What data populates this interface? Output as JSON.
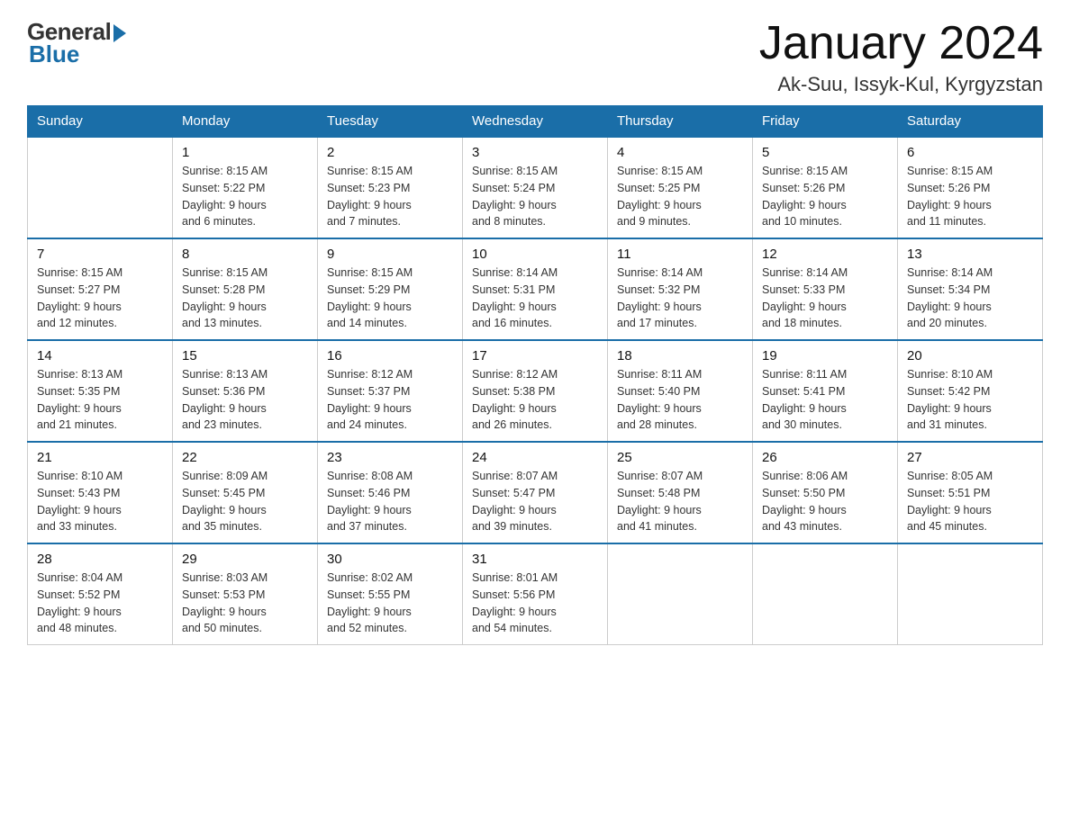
{
  "header": {
    "logo": {
      "general": "General",
      "blue": "Blue"
    },
    "month": "January 2024",
    "location": "Ak-Suu, Issyk-Kul, Kyrgyzstan"
  },
  "weekdays": [
    "Sunday",
    "Monday",
    "Tuesday",
    "Wednesday",
    "Thursday",
    "Friday",
    "Saturday"
  ],
  "weeks": [
    [
      {
        "day": "",
        "info": ""
      },
      {
        "day": "1",
        "info": "Sunrise: 8:15 AM\nSunset: 5:22 PM\nDaylight: 9 hours\nand 6 minutes."
      },
      {
        "day": "2",
        "info": "Sunrise: 8:15 AM\nSunset: 5:23 PM\nDaylight: 9 hours\nand 7 minutes."
      },
      {
        "day": "3",
        "info": "Sunrise: 8:15 AM\nSunset: 5:24 PM\nDaylight: 9 hours\nand 8 minutes."
      },
      {
        "day": "4",
        "info": "Sunrise: 8:15 AM\nSunset: 5:25 PM\nDaylight: 9 hours\nand 9 minutes."
      },
      {
        "day": "5",
        "info": "Sunrise: 8:15 AM\nSunset: 5:26 PM\nDaylight: 9 hours\nand 10 minutes."
      },
      {
        "day": "6",
        "info": "Sunrise: 8:15 AM\nSunset: 5:26 PM\nDaylight: 9 hours\nand 11 minutes."
      }
    ],
    [
      {
        "day": "7",
        "info": "Sunrise: 8:15 AM\nSunset: 5:27 PM\nDaylight: 9 hours\nand 12 minutes."
      },
      {
        "day": "8",
        "info": "Sunrise: 8:15 AM\nSunset: 5:28 PM\nDaylight: 9 hours\nand 13 minutes."
      },
      {
        "day": "9",
        "info": "Sunrise: 8:15 AM\nSunset: 5:29 PM\nDaylight: 9 hours\nand 14 minutes."
      },
      {
        "day": "10",
        "info": "Sunrise: 8:14 AM\nSunset: 5:31 PM\nDaylight: 9 hours\nand 16 minutes."
      },
      {
        "day": "11",
        "info": "Sunrise: 8:14 AM\nSunset: 5:32 PM\nDaylight: 9 hours\nand 17 minutes."
      },
      {
        "day": "12",
        "info": "Sunrise: 8:14 AM\nSunset: 5:33 PM\nDaylight: 9 hours\nand 18 minutes."
      },
      {
        "day": "13",
        "info": "Sunrise: 8:14 AM\nSunset: 5:34 PM\nDaylight: 9 hours\nand 20 minutes."
      }
    ],
    [
      {
        "day": "14",
        "info": "Sunrise: 8:13 AM\nSunset: 5:35 PM\nDaylight: 9 hours\nand 21 minutes."
      },
      {
        "day": "15",
        "info": "Sunrise: 8:13 AM\nSunset: 5:36 PM\nDaylight: 9 hours\nand 23 minutes."
      },
      {
        "day": "16",
        "info": "Sunrise: 8:12 AM\nSunset: 5:37 PM\nDaylight: 9 hours\nand 24 minutes."
      },
      {
        "day": "17",
        "info": "Sunrise: 8:12 AM\nSunset: 5:38 PM\nDaylight: 9 hours\nand 26 minutes."
      },
      {
        "day": "18",
        "info": "Sunrise: 8:11 AM\nSunset: 5:40 PM\nDaylight: 9 hours\nand 28 minutes."
      },
      {
        "day": "19",
        "info": "Sunrise: 8:11 AM\nSunset: 5:41 PM\nDaylight: 9 hours\nand 30 minutes."
      },
      {
        "day": "20",
        "info": "Sunrise: 8:10 AM\nSunset: 5:42 PM\nDaylight: 9 hours\nand 31 minutes."
      }
    ],
    [
      {
        "day": "21",
        "info": "Sunrise: 8:10 AM\nSunset: 5:43 PM\nDaylight: 9 hours\nand 33 minutes."
      },
      {
        "day": "22",
        "info": "Sunrise: 8:09 AM\nSunset: 5:45 PM\nDaylight: 9 hours\nand 35 minutes."
      },
      {
        "day": "23",
        "info": "Sunrise: 8:08 AM\nSunset: 5:46 PM\nDaylight: 9 hours\nand 37 minutes."
      },
      {
        "day": "24",
        "info": "Sunrise: 8:07 AM\nSunset: 5:47 PM\nDaylight: 9 hours\nand 39 minutes."
      },
      {
        "day": "25",
        "info": "Sunrise: 8:07 AM\nSunset: 5:48 PM\nDaylight: 9 hours\nand 41 minutes."
      },
      {
        "day": "26",
        "info": "Sunrise: 8:06 AM\nSunset: 5:50 PM\nDaylight: 9 hours\nand 43 minutes."
      },
      {
        "day": "27",
        "info": "Sunrise: 8:05 AM\nSunset: 5:51 PM\nDaylight: 9 hours\nand 45 minutes."
      }
    ],
    [
      {
        "day": "28",
        "info": "Sunrise: 8:04 AM\nSunset: 5:52 PM\nDaylight: 9 hours\nand 48 minutes."
      },
      {
        "day": "29",
        "info": "Sunrise: 8:03 AM\nSunset: 5:53 PM\nDaylight: 9 hours\nand 50 minutes."
      },
      {
        "day": "30",
        "info": "Sunrise: 8:02 AM\nSunset: 5:55 PM\nDaylight: 9 hours\nand 52 minutes."
      },
      {
        "day": "31",
        "info": "Sunrise: 8:01 AM\nSunset: 5:56 PM\nDaylight: 9 hours\nand 54 minutes."
      },
      {
        "day": "",
        "info": ""
      },
      {
        "day": "",
        "info": ""
      },
      {
        "day": "",
        "info": ""
      }
    ]
  ]
}
